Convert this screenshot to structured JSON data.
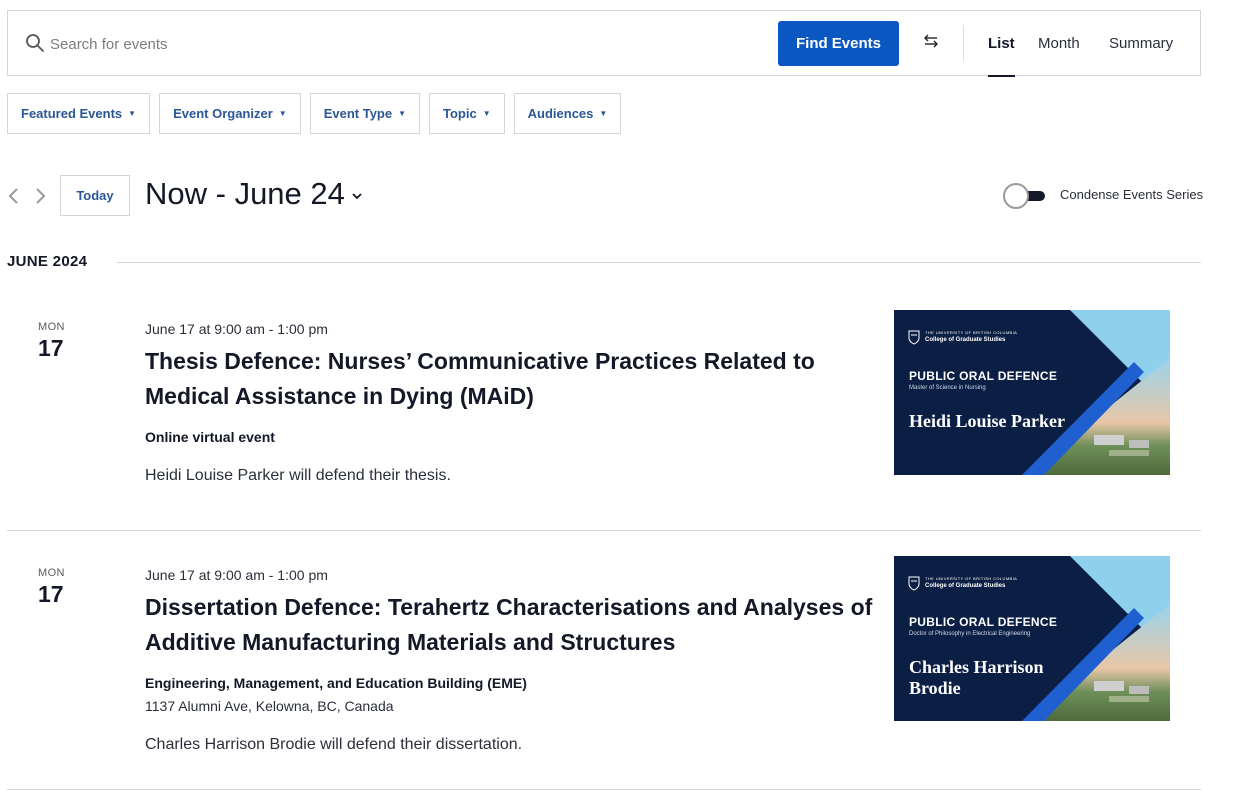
{
  "search": {
    "placeholder": "Search for events",
    "button_label": "Find Events"
  },
  "view_tabs": [
    {
      "label": "List",
      "active": true
    },
    {
      "label": "Month",
      "active": false
    },
    {
      "label": "Summary",
      "active": false
    }
  ],
  "filters": [
    {
      "label": "Featured Events"
    },
    {
      "label": "Event Organizer"
    },
    {
      "label": "Event Type"
    },
    {
      "label": "Topic"
    },
    {
      "label": "Audiences"
    }
  ],
  "date_nav": {
    "today_label": "Today",
    "range_label": "Now - June 24"
  },
  "condense_toggle": {
    "label": "Condense Events Series",
    "on": false
  },
  "month_separator": "JUNE 2024",
  "events": [
    {
      "dow": "MON",
      "day": "17",
      "time": "June 17 at 9:00 am - 1:00 pm",
      "title": "Thesis Defence: Nurses’ Communicative Practices Related to Medical Assistance in Dying (MAiD)",
      "venue": "Online virtual event",
      "address": "",
      "description": "Heidi Louise Parker will defend their thesis.",
      "image": {
        "university": "THE UNIVERSITY OF BRITISH COLUMBIA",
        "college": "College of Graduate Studies",
        "heading": "PUBLIC ORAL DEFENCE",
        "degree": "Master of Science in Nursing",
        "person": "Heidi Louise Parker"
      }
    },
    {
      "dow": "MON",
      "day": "17",
      "time": "June 17 at 9:00 am - 1:00 pm",
      "title": "Dissertation Defence: Terahertz Characterisations and Analyses of Additive Manufacturing Materials and Structures",
      "venue": "Engineering, Management, and Education Building (EME)",
      "address": "1137 Alumni Ave, Kelowna, BC, Canada",
      "description": "Charles Harrison Brodie will defend their dissertation.",
      "image": {
        "university": "THE UNIVERSITY OF BRITISH COLUMBIA",
        "college": "College of Graduate Studies",
        "heading": "PUBLIC ORAL DEFENCE",
        "degree": "Doctor of Philosophy in Electrical Engineering",
        "person": "Charles Harrison Brodie"
      }
    }
  ],
  "colors": {
    "primary_button": "#0a57c2",
    "filter_text": "#2b5797",
    "image_background": "#0b1f44",
    "image_accent_light": "#8fd0ec",
    "image_accent_blue": "#1f5fd0"
  }
}
